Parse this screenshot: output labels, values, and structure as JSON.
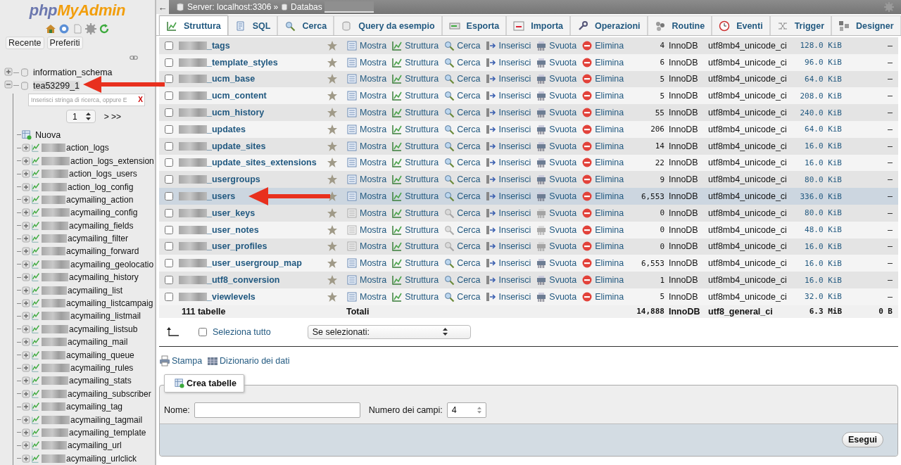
{
  "logo": {
    "part_1": "php",
    "part_2": "MyAdmin"
  },
  "sidebar": {
    "buttons": [
      "Recente",
      "Preferiti"
    ],
    "databases": [
      {
        "label": "information_schema",
        "expanded": false
      },
      {
        "label": "tea53299_1",
        "expanded": true,
        "filter_placeholder": "Inserisci stringa di ricerca, oppure E",
        "filter_clear": "X",
        "page": "1",
        "pager": "> >>",
        "new_label": "Nuova",
        "children": [
          {
            "label": "action_logs"
          },
          {
            "label": "action_logs_extension"
          },
          {
            "label": "action_logs_users"
          },
          {
            "label": "action_log_config"
          },
          {
            "label": "acymailing_action"
          },
          {
            "label": "acymailing_config"
          },
          {
            "label": "acymailing_fields"
          },
          {
            "label": "acymailing_filter"
          },
          {
            "label": "acymailing_forward"
          },
          {
            "label": "acymailing_geolocatio"
          },
          {
            "label": "acymailing_history"
          },
          {
            "label": "acymailing_list"
          },
          {
            "label": "acymailing_listcampaig"
          },
          {
            "label": "acymailing_listmail"
          },
          {
            "label": "acymailing_listsub"
          },
          {
            "label": "acymailing_mail"
          },
          {
            "label": "acymailing_queue"
          },
          {
            "label": "acymailing_rules"
          },
          {
            "label": "acymailing_stats"
          },
          {
            "label": "acymailing_subscriber"
          },
          {
            "label": "acymailing_tag"
          },
          {
            "label": "acymailing_tagmail"
          },
          {
            "label": "acymailing_template"
          },
          {
            "label": "acymailing_url"
          },
          {
            "label": "acymailing_urlclick"
          }
        ]
      }
    ]
  },
  "breadcrumb": {
    "back": "←",
    "server": "Server: localhost:3306",
    "separator": "»",
    "database": "Databas"
  },
  "tabs": [
    {
      "label": "Struttura",
      "selected": true
    },
    {
      "label": "SQL",
      "selected": false
    },
    {
      "label": "Cerca",
      "selected": false
    },
    {
      "label": "Query da esempio",
      "selected": false
    },
    {
      "label": "Esporta",
      "selected": false
    },
    {
      "label": "Importa",
      "selected": false
    },
    {
      "label": "Operazioni",
      "selected": false
    },
    {
      "label": "Routine",
      "selected": false
    },
    {
      "label": "Eventi",
      "selected": false
    },
    {
      "label": "Trigger",
      "selected": false
    },
    {
      "label": "Designer",
      "selected": false
    }
  ],
  "table": {
    "rows": [
      {
        "name": "_tags",
        "actions": [
          "Mostra",
          "Struttura",
          "Cerca",
          "Inserisci",
          "Svuota",
          "Elimina"
        ],
        "records": "4",
        "engine": "InnoDB",
        "collation": "utf8mb4_unicode_ci",
        "size": "128.0 KiB",
        "overhead": "–",
        "highlighted": false,
        "empty": false
      },
      {
        "name": "_template_styles",
        "actions": [
          "Mostra",
          "Struttura",
          "Cerca",
          "Inserisci",
          "Svuota",
          "Elimina"
        ],
        "records": "6",
        "engine": "InnoDB",
        "collation": "utf8mb4_unicode_ci",
        "size": "96.0 KiB",
        "overhead": "–",
        "highlighted": false,
        "empty": false
      },
      {
        "name": "_ucm_base",
        "actions": [
          "Mostra",
          "Struttura",
          "Cerca",
          "Inserisci",
          "Svuota",
          "Elimina"
        ],
        "records": "5",
        "engine": "InnoDB",
        "collation": "utf8mb4_unicode_ci",
        "size": "64.0 KiB",
        "overhead": "–",
        "highlighted": false,
        "empty": false
      },
      {
        "name": "_ucm_content",
        "actions": [
          "Mostra",
          "Struttura",
          "Cerca",
          "Inserisci",
          "Svuota",
          "Elimina"
        ],
        "records": "5",
        "engine": "InnoDB",
        "collation": "utf8mb4_unicode_ci",
        "size": "208.0 KiB",
        "overhead": "–",
        "highlighted": false,
        "empty": false
      },
      {
        "name": "_ucm_history",
        "actions": [
          "Mostra",
          "Struttura",
          "Cerca",
          "Inserisci",
          "Svuota",
          "Elimina"
        ],
        "records": "55",
        "engine": "InnoDB",
        "collation": "utf8mb4_unicode_ci",
        "size": "240.0 KiB",
        "overhead": "–",
        "highlighted": false,
        "empty": false
      },
      {
        "name": "_updates",
        "actions": [
          "Mostra",
          "Struttura",
          "Cerca",
          "Inserisci",
          "Svuota",
          "Elimina"
        ],
        "records": "206",
        "engine": "InnoDB",
        "collation": "utf8mb4_unicode_ci",
        "size": "64.0 KiB",
        "overhead": "–",
        "highlighted": false,
        "empty": false
      },
      {
        "name": "_update_sites",
        "actions": [
          "Mostra",
          "Struttura",
          "Cerca",
          "Inserisci",
          "Svuota",
          "Elimina"
        ],
        "records": "14",
        "engine": "InnoDB",
        "collation": "utf8mb4_unicode_ci",
        "size": "16.0 KiB",
        "overhead": "–",
        "highlighted": false,
        "empty": false
      },
      {
        "name": "_update_sites_extensions",
        "actions": [
          "Mostra",
          "Struttura",
          "Cerca",
          "Inserisci",
          "Svuota",
          "Elimina"
        ],
        "records": "22",
        "engine": "InnoDB",
        "collation": "utf8mb4_unicode_ci",
        "size": "16.0 KiB",
        "overhead": "–",
        "highlighted": false,
        "empty": false
      },
      {
        "name": "_usergroups",
        "actions": [
          "Mostra",
          "Struttura",
          "Cerca",
          "Inserisci",
          "Svuota",
          "Elimina"
        ],
        "records": "9",
        "engine": "InnoDB",
        "collation": "utf8mb4_unicode_ci",
        "size": "80.0 KiB",
        "overhead": "–",
        "highlighted": false,
        "empty": false
      },
      {
        "name": "_users",
        "actions": [
          "Mostra",
          "Struttura",
          "Cerca",
          "Inserisci",
          "Svuota",
          "Elimina"
        ],
        "records": "6,553",
        "engine": "InnoDB",
        "collation": "utf8mb4_unicode_ci",
        "size": "336.0 KiB",
        "overhead": "–",
        "highlighted": true,
        "empty": false
      },
      {
        "name": "_user_keys",
        "actions": [
          "Mostra",
          "Struttura",
          "Cerca",
          "Inserisci",
          "Svuota",
          "Elimina"
        ],
        "records": "0",
        "engine": "InnoDB",
        "collation": "utf8mb4_unicode_ci",
        "size": "80.0 KiB",
        "overhead": "–",
        "highlighted": false,
        "empty": true
      },
      {
        "name": "_user_notes",
        "actions": [
          "Mostra",
          "Struttura",
          "Cerca",
          "Inserisci",
          "Svuota",
          "Elimina"
        ],
        "records": "0",
        "engine": "InnoDB",
        "collation": "utf8mb4_unicode_ci",
        "size": "48.0 KiB",
        "overhead": "–",
        "highlighted": false,
        "empty": true
      },
      {
        "name": "_user_profiles",
        "actions": [
          "Mostra",
          "Struttura",
          "Cerca",
          "Inserisci",
          "Svuota",
          "Elimina"
        ],
        "records": "0",
        "engine": "InnoDB",
        "collation": "utf8mb4_unicode_ci",
        "size": "16.0 KiB",
        "overhead": "–",
        "highlighted": false,
        "empty": true
      },
      {
        "name": "_user_usergroup_map",
        "actions": [
          "Mostra",
          "Struttura",
          "Cerca",
          "Inserisci",
          "Svuota",
          "Elimina"
        ],
        "records": "6,553",
        "engine": "InnoDB",
        "collation": "utf8mb4_unicode_ci",
        "size": "16.0 KiB",
        "overhead": "–",
        "highlighted": false,
        "empty": false
      },
      {
        "name": "_utf8_conversion",
        "actions": [
          "Mostra",
          "Struttura",
          "Cerca",
          "Inserisci",
          "Svuota",
          "Elimina"
        ],
        "records": "1",
        "engine": "InnoDB",
        "collation": "utf8mb4_unicode_ci",
        "size": "16.0 KiB",
        "overhead": "–",
        "highlighted": false,
        "empty": false
      },
      {
        "name": "_viewlevels",
        "actions": [
          "Mostra",
          "Struttura",
          "Cerca",
          "Inserisci",
          "Svuota",
          "Elimina"
        ],
        "records": "5",
        "engine": "InnoDB",
        "collation": "utf8mb4_unicode_ci",
        "size": "32.0 KiB",
        "overhead": "–",
        "highlighted": false,
        "empty": false
      }
    ],
    "footer": {
      "count": "111 tabelle",
      "label": "Totali",
      "records": "14,888",
      "engine": "InnoDB",
      "collation": "utf8_general_ci",
      "size": "6.3 MiB",
      "overhead": "0 B"
    }
  },
  "bulk": {
    "select_all": "Seleziona tutto",
    "checked": false,
    "action_select": "Se selezionati:"
  },
  "links": [
    "Stampa",
    "Dizionario dei dati"
  ],
  "create": {
    "legend": "Crea tabelle",
    "name_label": "Nome:",
    "fields_label": "Numero dei campi:",
    "fields_value": "4",
    "submit": "Esegui"
  }
}
